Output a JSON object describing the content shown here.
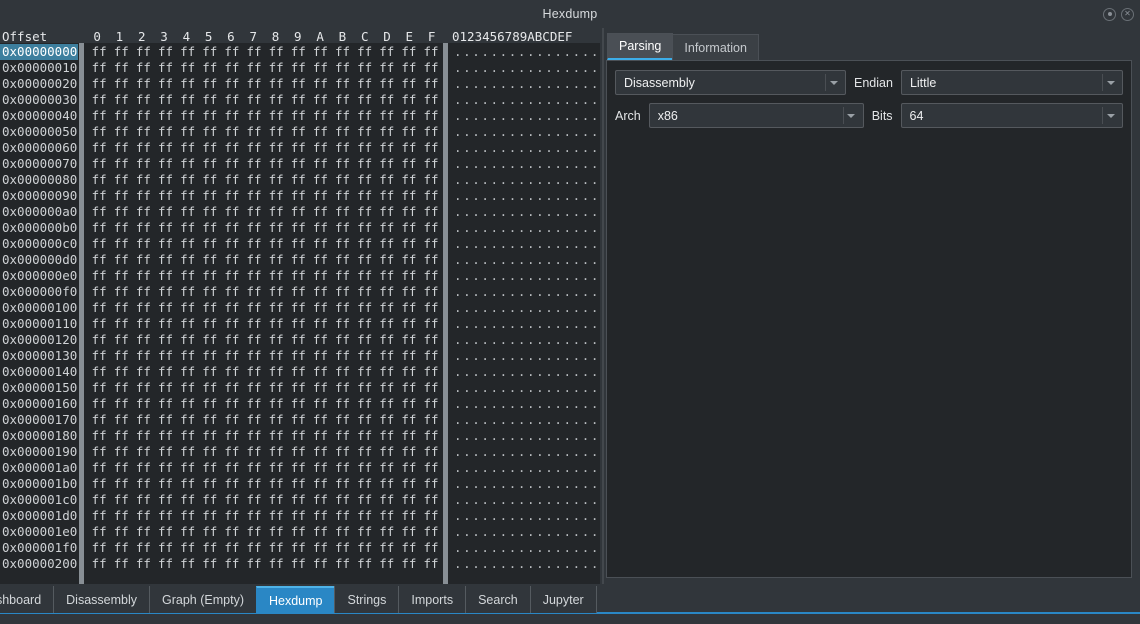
{
  "window": {
    "title": "Hexdump",
    "buttons": [
      {
        "name": "settings-icon",
        "glyph": "◎"
      },
      {
        "name": "close-icon",
        "glyph": "✕"
      }
    ]
  },
  "hexdump": {
    "offset_header": "Offset",
    "byte_columns": [
      "0",
      "1",
      "2",
      "3",
      "4",
      "5",
      "6",
      "7",
      "8",
      "9",
      "A",
      "B",
      "C",
      "D",
      "E",
      "F"
    ],
    "ascii_header": "0123456789ABCDEF",
    "selected_offset": "0x00000000",
    "byte_value": "ff",
    "ascii_placeholder": "................",
    "rows": [
      "0x00000000",
      "0x00000010",
      "0x00000020",
      "0x00000030",
      "0x00000040",
      "0x00000050",
      "0x00000060",
      "0x00000070",
      "0x00000080",
      "0x00000090",
      "0x000000a0",
      "0x000000b0",
      "0x000000c0",
      "0x000000d0",
      "0x000000e0",
      "0x000000f0",
      "0x00000100",
      "0x00000110",
      "0x00000120",
      "0x00000130",
      "0x00000140",
      "0x00000150",
      "0x00000160",
      "0x00000170",
      "0x00000180",
      "0x00000190",
      "0x000001a0",
      "0x000001b0",
      "0x000001c0",
      "0x000001d0",
      "0x000001e0",
      "0x000001f0",
      "0x00000200"
    ]
  },
  "side_panel": {
    "tabs": [
      {
        "label": "Parsing",
        "active": true
      },
      {
        "label": "Information",
        "active": false
      }
    ],
    "controls": {
      "mode_value": "Disassembly",
      "endian_label": "Endian",
      "endian_value": "Little",
      "arch_label": "Arch",
      "arch_value": "x86",
      "bits_label": "Bits",
      "bits_value": "64"
    }
  },
  "bottom_tabs": [
    {
      "label": "Dashboard",
      "active": false
    },
    {
      "label": "Disassembly",
      "active": false
    },
    {
      "label": "Graph (Empty)",
      "active": false
    },
    {
      "label": "Hexdump",
      "active": true
    },
    {
      "label": "Strings",
      "active": false
    },
    {
      "label": "Imports",
      "active": false
    },
    {
      "label": "Search",
      "active": false
    },
    {
      "label": "Jupyter",
      "active": false
    }
  ],
  "colors": {
    "accent": "#3daee9",
    "active_tab": "#2a87c5",
    "selection": "#3d7f9e",
    "window_bg": "#31363b",
    "content_bg": "#232629"
  }
}
